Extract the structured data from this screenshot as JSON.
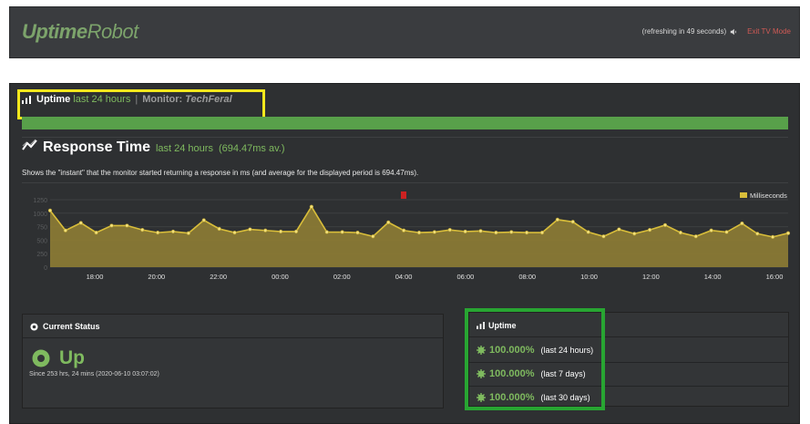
{
  "header": {
    "logo_bold": "Uptime",
    "logo_thin": "Robot",
    "refresh_text": "(refreshing in 49 seconds)",
    "exit_label": "Exit TV Mode"
  },
  "uptime_section": {
    "title": "Uptime",
    "period": "last 24 hours",
    "separator": "|",
    "monitor_label": "Monitor:",
    "monitor_name": "TechFeral"
  },
  "response_time": {
    "title": "Response Time",
    "period": "last 24 hours",
    "average": "(694.47ms av.)",
    "description": "Shows the \"instant\" that the monitor started returning a response in ms (and average for the displayed period is 694.47ms)."
  },
  "chart_data": {
    "type": "area",
    "legend": [
      "Milliseconds"
    ],
    "legend_position": "top-right",
    "y_ticks": [
      "1250",
      "1000",
      "750",
      "500",
      "250",
      "0"
    ],
    "ylim": [
      0,
      1250
    ],
    "x_ticks": [
      "18:00",
      "20:00",
      "22:00",
      "00:00",
      "02:00",
      "04:00",
      "06:00",
      "08:00",
      "10:00",
      "12:00",
      "14:00",
      "16:00"
    ],
    "series": [
      {
        "name": "Milliseconds",
        "values": [
          1050,
          680,
          820,
          640,
          770,
          770,
          690,
          640,
          660,
          630,
          870,
          710,
          640,
          700,
          680,
          660,
          660,
          1120,
          650,
          650,
          640,
          570,
          830,
          680,
          640,
          650,
          690,
          660,
          670,
          640,
          650,
          640,
          640,
          880,
          840,
          650,
          570,
          700,
          620,
          690,
          780,
          640,
          570,
          680,
          650,
          810,
          620,
          560,
          630
        ],
        "color": "#d9be3a"
      }
    ],
    "marker_color": "#cc2222",
    "grid": true
  },
  "current_status": {
    "title": "Current Status",
    "state": "Up",
    "since": "Since 253 hrs, 24 mins (2020-06-10 03:07:02)"
  },
  "uptime_stats": {
    "title": "Uptime",
    "items": [
      {
        "value": "100.000%",
        "period": "(last 24 hours)"
      },
      {
        "value": "100.000%",
        "period": "(last 7 days)"
      },
      {
        "value": "100.000%",
        "period": "(last 30 days)"
      }
    ]
  },
  "colors": {
    "accent_green": "#7fba5f",
    "highlight_yellow": "#f4e81d",
    "highlight_green": "#28a532",
    "exit_red": "#d05a55"
  }
}
